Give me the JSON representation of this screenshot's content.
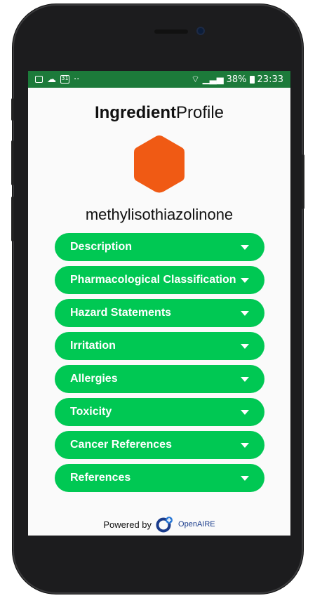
{
  "status_bar": {
    "battery": "38%",
    "time": "23:33",
    "calendar_day": "31",
    "dots": "··"
  },
  "app": {
    "title_bold": "Ingredient",
    "title_regular": "Profile"
  },
  "ingredient": {
    "name": "methylisothiazolinone",
    "icon_color": "#f05a14"
  },
  "sections": [
    {
      "label": "Description"
    },
    {
      "label": "Pharmacological Classification"
    },
    {
      "label": "Hazard Statements"
    },
    {
      "label": "Irritation"
    },
    {
      "label": "Allergies"
    },
    {
      "label": "Toxicity"
    },
    {
      "label": "Cancer References"
    },
    {
      "label": "References"
    }
  ],
  "footer": {
    "powered_by": "Powered by",
    "logo_text": "OpenAIRE"
  },
  "colors": {
    "status_bar": "#1c7a3a",
    "accordion": "#00c853",
    "hexagon": "#f05a14"
  }
}
